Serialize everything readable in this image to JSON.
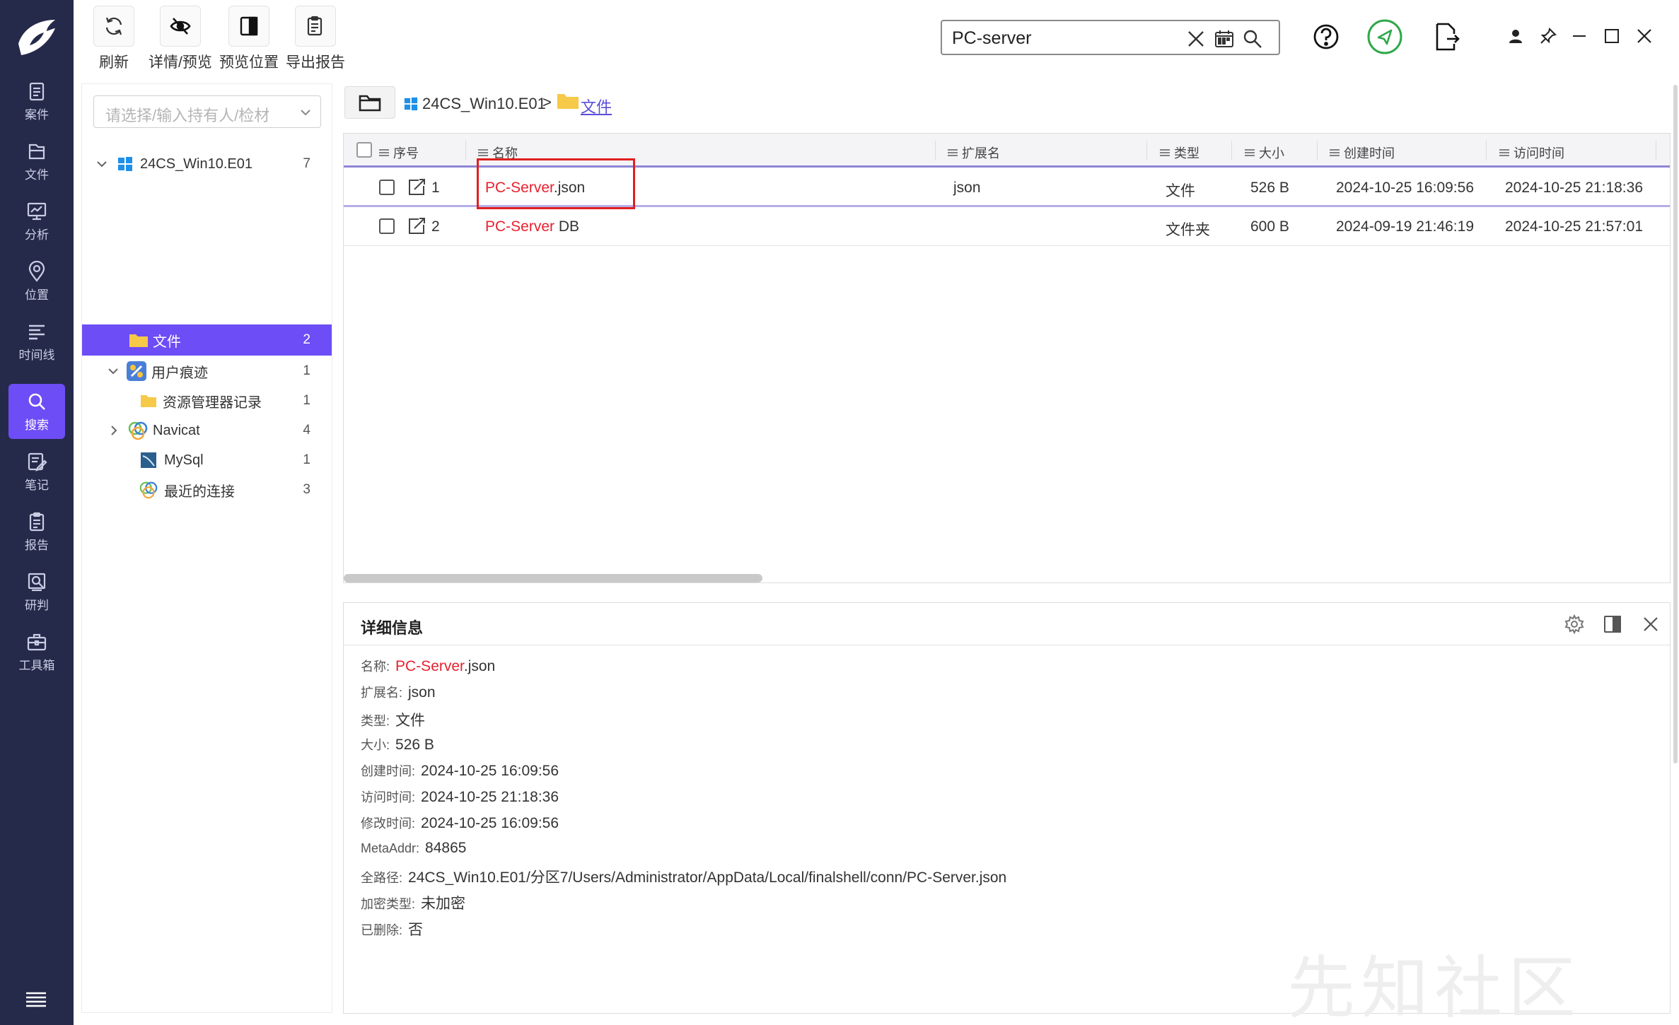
{
  "nav": {
    "items": [
      {
        "label": "案件",
        "icon": "clipboard-icon"
      },
      {
        "label": "文件",
        "icon": "file-icon"
      },
      {
        "label": "分析",
        "icon": "chart-monitor-icon"
      },
      {
        "label": "位置",
        "icon": "location-pin-icon"
      },
      {
        "label": "时间线",
        "icon": "timeline-icon"
      },
      {
        "label": "搜索",
        "icon": "search-icon",
        "active": true
      },
      {
        "label": "笔记",
        "icon": "note-icon"
      },
      {
        "label": "报告",
        "icon": "report-icon"
      },
      {
        "label": "研判",
        "icon": "analysis-icon"
      },
      {
        "label": "工具箱",
        "icon": "toolbox-icon"
      }
    ]
  },
  "toolbar": {
    "refresh": "刷新",
    "details_preview": "详情/预览",
    "preview_position": "预览位置",
    "export_report": "导出报告"
  },
  "search": {
    "value": "PC-server"
  },
  "owner_select": {
    "placeholder": "请选择/输入持有人/检材"
  },
  "tree": {
    "root": {
      "label": "24CS_Win10.E01",
      "count": "7"
    },
    "items": [
      {
        "label": "文件",
        "count": "2"
      },
      {
        "label": "用户痕迹",
        "count": "1"
      },
      {
        "label": "资源管理器记录",
        "count": "1"
      },
      {
        "label": "Navicat",
        "count": "4"
      },
      {
        "label": "MySql",
        "count": "1"
      },
      {
        "label": "最近的连接",
        "count": "3"
      }
    ]
  },
  "breadcrumb": {
    "root": "24CS_Win10.E01",
    "separator": ">",
    "current": "文件"
  },
  "table": {
    "columns": [
      "序号",
      "名称",
      "扩展名",
      "类型",
      "大小",
      "创建时间",
      "访问时间"
    ],
    "rows": [
      {
        "index": "1",
        "name_hit": "PC-Server",
        "name_rest": ".json",
        "ext": "json",
        "type": "文件",
        "size": "526 B",
        "created": "2024-10-25 16:09:56",
        "accessed": "2024-10-25 21:18:36"
      },
      {
        "index": "2",
        "name_hit": "PC-Server",
        "name_rest": " DB",
        "ext": "",
        "type": "文件夹",
        "size": "600 B",
        "created": "2024-09-19 21:46:19",
        "accessed": "2024-10-25 21:57:01"
      }
    ]
  },
  "details": {
    "title": "详细信息",
    "name_label": "名称:",
    "name_hit": "PC-Server",
    "name_rest": ".json",
    "ext_label": "扩展名:",
    "ext": "json",
    "type_label": "类型:",
    "type": "文件",
    "size_label": "大小:",
    "size": "526 B",
    "created_label": "创建时间:",
    "created": "2024-10-25 16:09:56",
    "accessed_label": "访问时间:",
    "accessed": "2024-10-25 21:18:36",
    "modified_label": "修改时间:",
    "modified": "2024-10-25 16:09:56",
    "metaaddr_label": "MetaAddr:",
    "metaaddr": "84865",
    "path_label": "全路径:",
    "path": "24CS_Win10.E01/分区7/Users/Administrator/AppData/Local/finalshell/conn/PC-Server.json",
    "encrypt_label": "加密类型:",
    "encrypt": "未加密",
    "deleted_label": "已删除:",
    "deleted": "否"
  },
  "watermark": "先知社区",
  "colors": {
    "nav_bg": "#252a4a",
    "accent": "#6d4df5",
    "hit_red": "#e8212f",
    "highlight_box": "#e01f1f"
  }
}
